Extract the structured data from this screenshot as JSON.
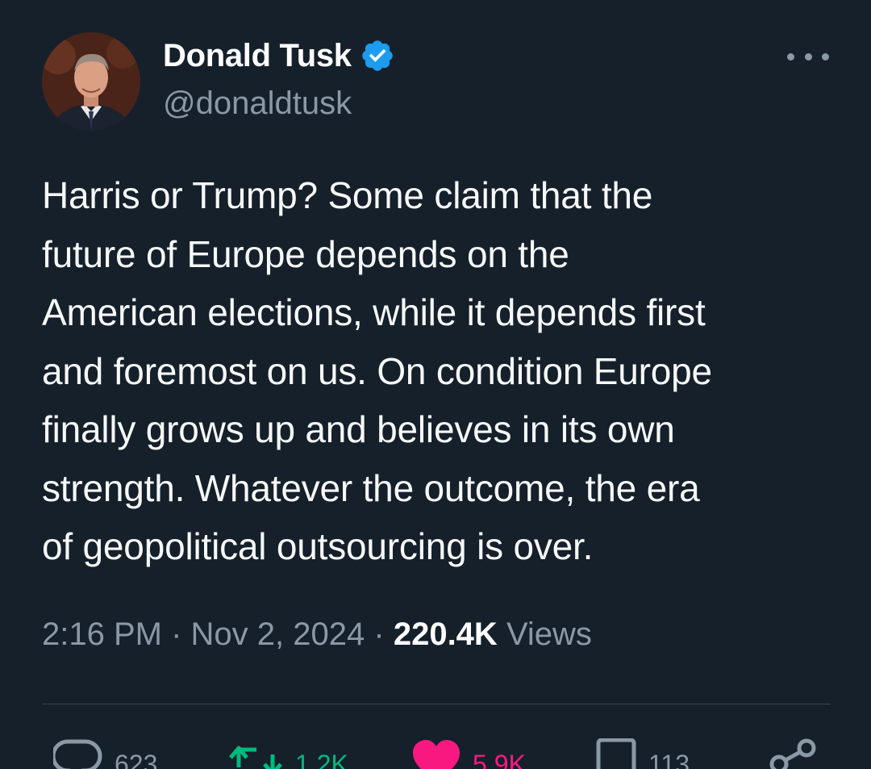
{
  "author": {
    "display_name": "Donald Tusk",
    "handle": "@donaldtusk",
    "verified": true,
    "verified_color": "#1d9bf0"
  },
  "tweet": {
    "text": "Harris or Trump? Some claim that the\nfuture of Europe depends on the\nAmerican elections, while it depends first\nand foremost on us. On condition Europe\nfinally grows up and believes in its own\nstrength. Whatever the outcome, the era\nof geopolitical outsourcing is over.",
    "time": "2:16 PM",
    "separator": "·",
    "date": "Nov 2, 2024",
    "views_count": "220.4K",
    "views_label": "Views"
  },
  "actions": {
    "replies": "623",
    "retweets": "1.2K",
    "likes": "5.9K",
    "bookmarks": "113"
  },
  "icons": {
    "more": "more-options-icon",
    "reply": "reply-icon",
    "retweet": "retweet-icon",
    "like": "heart-icon",
    "bookmark": "bookmark-icon",
    "share": "share-icon"
  },
  "colors": {
    "background": "#15202b",
    "secondary_text": "#8b98a5",
    "retweet_active": "#00ba7c",
    "like_active": "#f91880",
    "divider": "#38444d"
  }
}
